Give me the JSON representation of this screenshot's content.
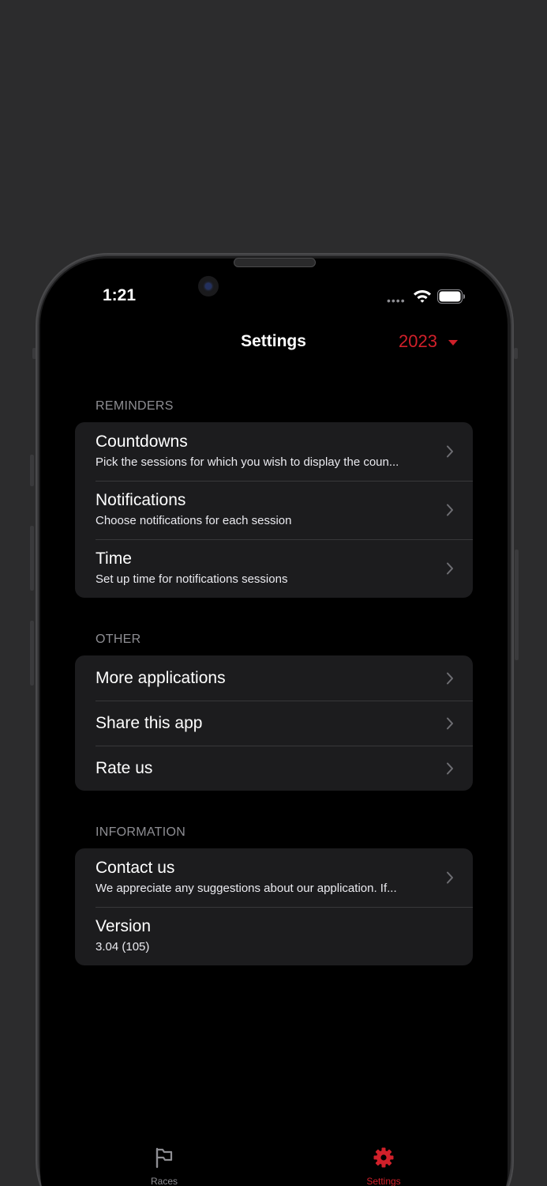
{
  "status_bar": {
    "time": "1:21",
    "signal_dots": "••••"
  },
  "nav": {
    "title": "Settings",
    "year": "2023"
  },
  "sections": [
    {
      "header": "REMINDERS",
      "rows": [
        {
          "title": "Countdowns",
          "subtitle": "Pick the sessions for which you wish to display the coun..."
        },
        {
          "title": "Notifications",
          "subtitle": "Choose notifications for each session"
        },
        {
          "title": "Time",
          "subtitle": "Set up time for notifications sessions"
        }
      ]
    },
    {
      "header": "OTHER",
      "rows": [
        {
          "title": "More applications"
        },
        {
          "title": "Share this app"
        },
        {
          "title": "Rate us"
        }
      ]
    },
    {
      "header": "INFORMATION",
      "rows": [
        {
          "title": "Contact us",
          "subtitle": "We appreciate any suggestions about our application. If..."
        },
        {
          "title": "Version",
          "subtitle": "3.04 (105)"
        }
      ]
    }
  ],
  "tab_bar": {
    "tabs": [
      {
        "label": "Races",
        "icon": "flag-icon",
        "active": false
      },
      {
        "label": "Settings",
        "icon": "gear-icon",
        "active": true
      }
    ]
  },
  "colors": {
    "accent": "#d0202a",
    "background": "#000000",
    "group_background": "#1c1c1e",
    "inactive_tab": "#8e8e93"
  }
}
